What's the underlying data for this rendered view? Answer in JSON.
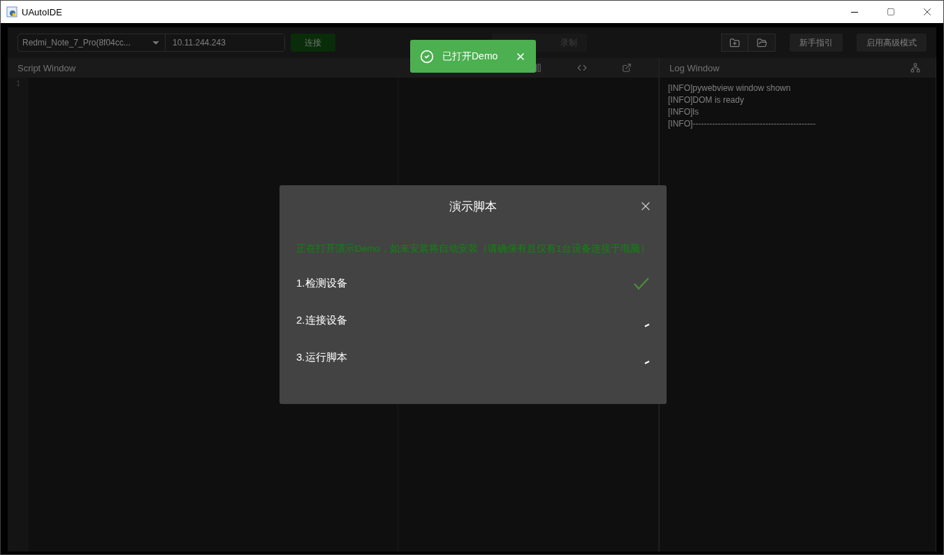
{
  "window": {
    "title": "UAutoIDE"
  },
  "toolbar": {
    "device": "Redmi_Note_7_Pro(8f04cc...",
    "ip": "10.11.244.243",
    "connect": "连接",
    "record": "录制",
    "guide": "新手指引",
    "advanced": "启用高级模式"
  },
  "script_window": {
    "title": "Script Window",
    "line_numbers": [
      "1"
    ]
  },
  "log_window": {
    "title": "Log Window",
    "lines": [
      "[INFO]pywebview window shown",
      "[INFO]DOM is ready",
      "[INFO]ls",
      "[INFO]--------------------------------------------"
    ]
  },
  "toast": {
    "message": "已打开Demo"
  },
  "dialog": {
    "title": "演示脚本",
    "notice": "正在打开演示Demo，如未安装将自动安装（请确保有且仅有1台设备连接于电脑）",
    "steps": [
      {
        "label": "1.检测设备",
        "done": true
      },
      {
        "label": "2.连接设备",
        "done": false
      },
      {
        "label": "3.运行脚本",
        "done": false
      }
    ]
  }
}
